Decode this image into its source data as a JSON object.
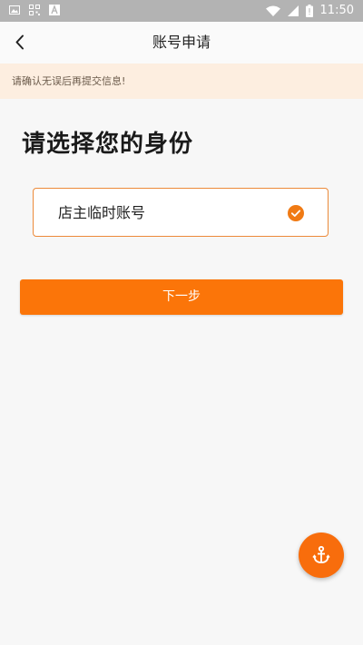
{
  "status_bar": {
    "time": "11:50",
    "icons": [
      "image-icon",
      "qr-icon",
      "a-icon",
      "wifi-icon",
      "signal-icon",
      "battery-icon"
    ]
  },
  "navbar": {
    "back_icon": "chevron-left-icon",
    "title": "账号申请"
  },
  "notice": {
    "text": "请确认无误后再提交信息!"
  },
  "main": {
    "heading": "请选择您的身份",
    "option": {
      "label": "店主临时账号",
      "selected": true,
      "icon": "check-circle-icon"
    },
    "next_button": "下一步"
  },
  "fab": {
    "icon": "anchor-icon"
  },
  "colors": {
    "accent": "#fb7509",
    "notice_bg": "#fdeee0",
    "border": "#ec8a3a"
  }
}
